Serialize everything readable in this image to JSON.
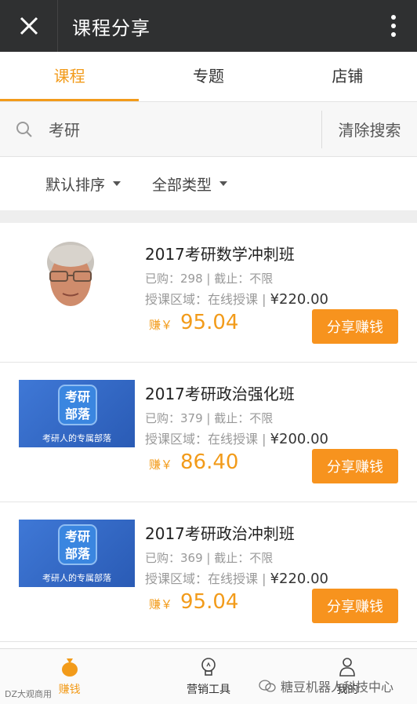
{
  "header": {
    "title": "课程分享"
  },
  "tabs": [
    {
      "label": "课程",
      "active": true
    },
    {
      "label": "专题",
      "active": false
    },
    {
      "label": "店铺",
      "active": false
    }
  ],
  "search": {
    "value": "考研",
    "clear_label": "清除搜索"
  },
  "filters": {
    "sort_label": "默认排序",
    "type_label": "全部类型"
  },
  "courses": [
    {
      "title": "2017考研数学冲刺班",
      "purchased": "已购：298 | 截止：不限",
      "area": "授课区域：在线授课 | ",
      "price": "¥220.00",
      "earn_label": "赚￥",
      "earn_value": "95.04",
      "share_label": "分享赚钱",
      "thumb": "portrait"
    },
    {
      "title": "2017考研政治强化班",
      "purchased": "已购：379 | 截止：不限",
      "area": "授课区域：在线授课 | ",
      "price": "¥200.00",
      "earn_label": "赚￥",
      "earn_value": "86.40",
      "share_label": "分享赚钱",
      "thumb": "brand",
      "brand_text": "考研部落",
      "brand_sub": "考研人的专属部落"
    },
    {
      "title": "2017考研政治冲刺班",
      "purchased": "已购：369 | 截止：不限",
      "area": "授课区域：在线授课 | ",
      "price": "¥220.00",
      "earn_label": "赚￥",
      "earn_value": "95.04",
      "share_label": "分享赚钱",
      "thumb": "brand",
      "brand_text": "考研部落",
      "brand_sub": "考研人的专属部落"
    }
  ],
  "bottom_nav": [
    {
      "label": "赚钱",
      "icon": "money-bag-icon",
      "active": true
    },
    {
      "label": "营销工具",
      "icon": "lightbulb-icon",
      "active": false
    },
    {
      "label": "我的",
      "icon": "user-icon",
      "active": false
    }
  ],
  "watermark": {
    "right": "糖豆机器人科技中心",
    "left": "DZ大观商用"
  },
  "colors": {
    "accent": "#f29b1a",
    "titlebar": "#2f3031",
    "share_button": "#f7931e"
  }
}
